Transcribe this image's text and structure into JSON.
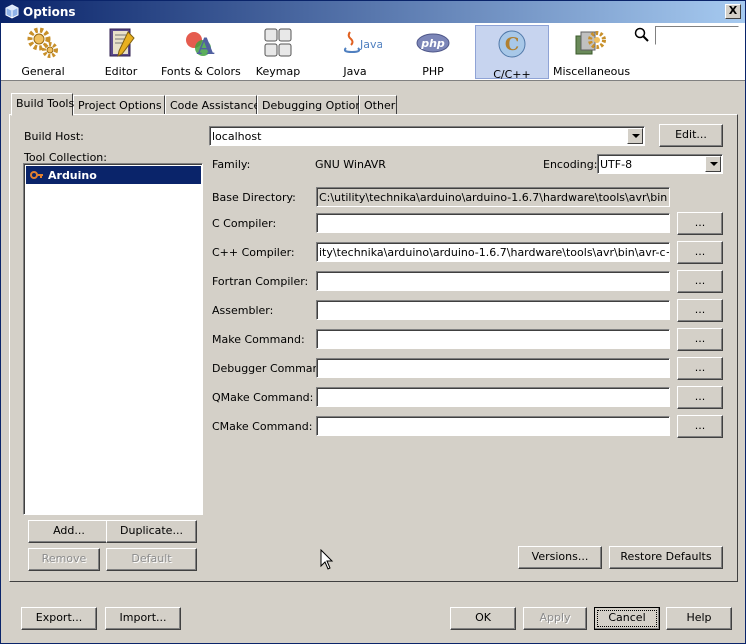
{
  "window": {
    "title": "Options",
    "close_label": "X"
  },
  "categories": [
    {
      "label": "General",
      "icon": "gear-icon"
    },
    {
      "label": "Editor",
      "icon": "editor-icon"
    },
    {
      "label": "Fonts & Colors",
      "icon": "fonts-colors-icon"
    },
    {
      "label": "Keymap",
      "icon": "keymap-icon"
    },
    {
      "label": "Java",
      "icon": "java-icon"
    },
    {
      "label": "PHP",
      "icon": "php-icon"
    },
    {
      "label": "C/C++",
      "icon": "cpp-icon",
      "selected": true
    },
    {
      "label": "Miscellaneous",
      "icon": "miscellaneous-icon"
    }
  ],
  "search": {
    "value": ""
  },
  "tabs": [
    {
      "label": "Build Tools",
      "active": true
    },
    {
      "label": "Project Options"
    },
    {
      "label": "Code Assistance"
    },
    {
      "label": "Debugging Options"
    },
    {
      "label": "Other"
    }
  ],
  "build": {
    "host_label": "Build Host:",
    "host_value": "localhost",
    "edit_label": "Edit...",
    "tool_collection_label": "Tool Collection:",
    "tool_collections": [
      "Arduino"
    ],
    "family_label": "Family:",
    "family_value": "GNU WinAVR",
    "encoding_label": "Encoding:",
    "encoding_value": "UTF-8",
    "base_dir_label": "Base Directory:",
    "base_dir_value": "C:\\utility\\technika\\arduino\\arduino-1.6.7\\hardware\\tools\\avr\\bin",
    "fields": [
      {
        "label": "C Compiler:",
        "value": ""
      },
      {
        "label": "C++ Compiler:",
        "value": "ity\\technika\\arduino\\arduino-1.6.7\\hardware\\tools\\avr\\bin\\avr-c++.exe"
      },
      {
        "label": "Fortran Compiler:",
        "value": ""
      },
      {
        "label": "Assembler:",
        "value": ""
      },
      {
        "label": "Make Command:",
        "value": ""
      },
      {
        "label": "Debugger Command:",
        "value": ""
      },
      {
        "label": "QMake Command:",
        "value": ""
      },
      {
        "label": "CMake Command:",
        "value": ""
      }
    ],
    "browse_label": "...",
    "add_label": "Add...",
    "duplicate_label": "Duplicate...",
    "remove_label": "Remove",
    "default_label": "Default",
    "versions_label": "Versions...",
    "restore_label": "Restore Defaults"
  },
  "footer": {
    "export_label": "Export...",
    "import_label": "Import...",
    "ok_label": "OK",
    "apply_label": "Apply",
    "cancel_label": "Cancel",
    "help_label": "Help"
  }
}
